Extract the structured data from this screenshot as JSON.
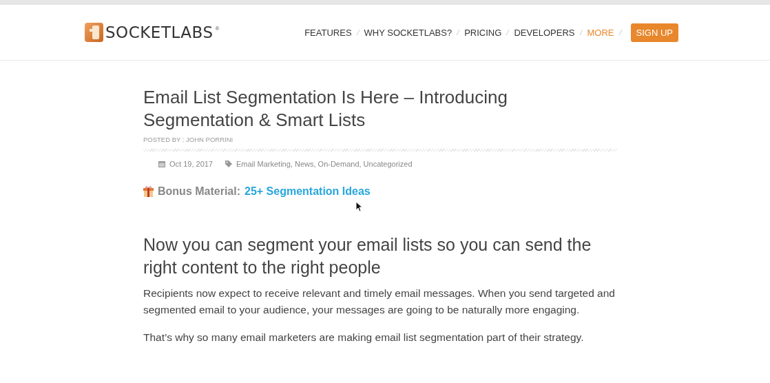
{
  "header": {
    "logo": {
      "text": "SOCKETLABS",
      "mark": "®"
    },
    "nav": [
      {
        "label": "FEATURES",
        "kind": "link",
        "selected": false
      },
      {
        "label": "WHY SOCKETLABS?",
        "kind": "link",
        "selected": false
      },
      {
        "label": "PRICING",
        "kind": "link",
        "selected": false
      },
      {
        "label": "DEVELOPERS",
        "kind": "link",
        "selected": false
      },
      {
        "label": "MORE",
        "kind": "link",
        "selected": true
      },
      {
        "label": "SIGN UP",
        "kind": "button",
        "selected": false
      }
    ]
  },
  "article": {
    "title": "Email List Segmentation Is Here – Introducing Segmentation & Smart Lists",
    "byline": "POSTED BY : JOHN PORRINI",
    "date": "Oct 19, 2017",
    "categories": "Email Marketing, News, On-Demand, Uncategorized",
    "bonus": {
      "label": "Bonus Material:",
      "link": "25+ Segmentation Ideas"
    },
    "heading": "Now you can segment your email lists so you can send the right content to the right people",
    "paragraphs": [
      "Recipients now expect to receive relevant and timely email messages. When you send targeted and segmented email to your audience, your messages are going to be naturally more engaging.",
      "That’s why so many email marketers are making email list segmentation part of their strategy."
    ]
  }
}
